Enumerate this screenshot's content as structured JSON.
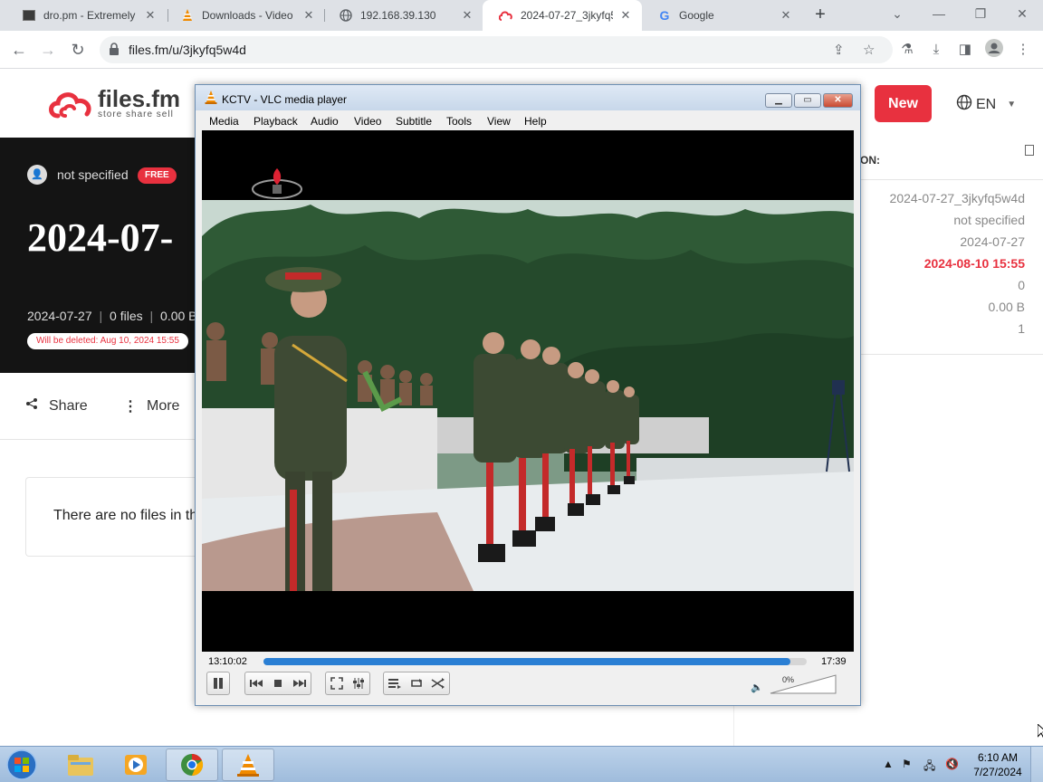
{
  "browser": {
    "tabs": [
      {
        "label": "dro.pm - Extremely",
        "icon": "dro-favicon"
      },
      {
        "label": "Downloads - Video",
        "icon": "vlc-cone-icon"
      },
      {
        "label": "192.168.39.130",
        "icon": "globe-icon"
      },
      {
        "label": "2024-07-27_3jkyfq5",
        "icon": "filesfm-favicon"
      },
      {
        "label": "Google",
        "icon": "google-g-icon"
      }
    ],
    "active_tab_index": 3,
    "url": "files.fm/u/3jkyfq5w4d"
  },
  "filesfm": {
    "logo_name": "files.fm",
    "logo_tagline": "store  share  sell",
    "new_button": "New",
    "language": "EN",
    "owner": "not specified",
    "plan_badge": "FREE",
    "title": "2024-07-",
    "meta_date": "2024-07-27",
    "meta_files": "0 files",
    "meta_size": "0.00  B",
    "delete_note": "Will be deleted: Aug 10, 2024 15:55",
    "share_label": "Share",
    "more_label": "More",
    "empty_text": "There are no files in th",
    "info_heading": "ON:",
    "info_values": [
      "2024-07-27_3jkyfq5w4d",
      "not specified",
      "2024-07-27",
      "2024-08-10 15:55",
      "0",
      "0.00  B",
      "1"
    ],
    "accent_color": "#e8313f"
  },
  "vlc": {
    "title": "KCTV - VLC media player",
    "menu": [
      "Media",
      "Playback",
      "Audio",
      "Video",
      "Subtitle",
      "Tools",
      "View",
      "Help"
    ],
    "elapsed": "13:10:02",
    "remaining": "17:39",
    "progress": 0.97,
    "volume": "0%"
  },
  "taskbar": {
    "time": "6:10 AM",
    "date": "7/27/2024"
  }
}
